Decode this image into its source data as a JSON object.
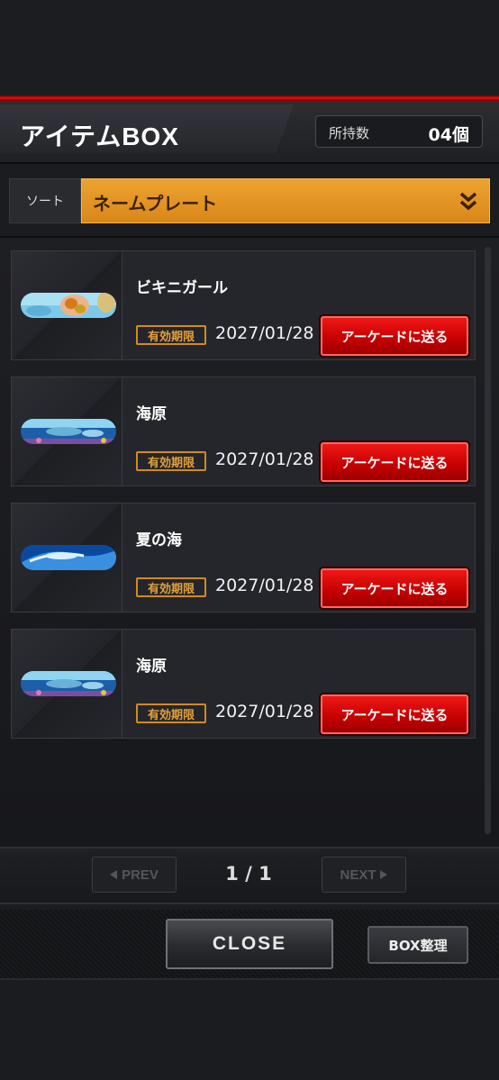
{
  "header": {
    "title": "アイテムBOX",
    "count_label": "所持数",
    "count_value": "04個"
  },
  "sort": {
    "label": "ソート",
    "value": "ネームプレート"
  },
  "items": [
    {
      "name": "ビキニガール",
      "expiry_label": "有効期限",
      "expiry_date": "2027/01/28",
      "send_label": "アーケードに送る"
    },
    {
      "name": "海原",
      "expiry_label": "有効期限",
      "expiry_date": "2027/01/28",
      "send_label": "アーケードに送る"
    },
    {
      "name": "夏の海",
      "expiry_label": "有効期限",
      "expiry_date": "2027/01/28",
      "send_label": "アーケードに送る"
    },
    {
      "name": "海原",
      "expiry_label": "有効期限",
      "expiry_date": "2027/01/28",
      "send_label": "アーケードに送る"
    }
  ],
  "pager": {
    "prev_label": "PREV",
    "next_label": "NEXT",
    "page": "1 / 1"
  },
  "footer": {
    "close_label": "CLOSE",
    "box_label": "BOX整理"
  },
  "colors": {
    "accent_orange": "#e39526",
    "send_red": "#d40000",
    "header_red": "#e01010"
  }
}
